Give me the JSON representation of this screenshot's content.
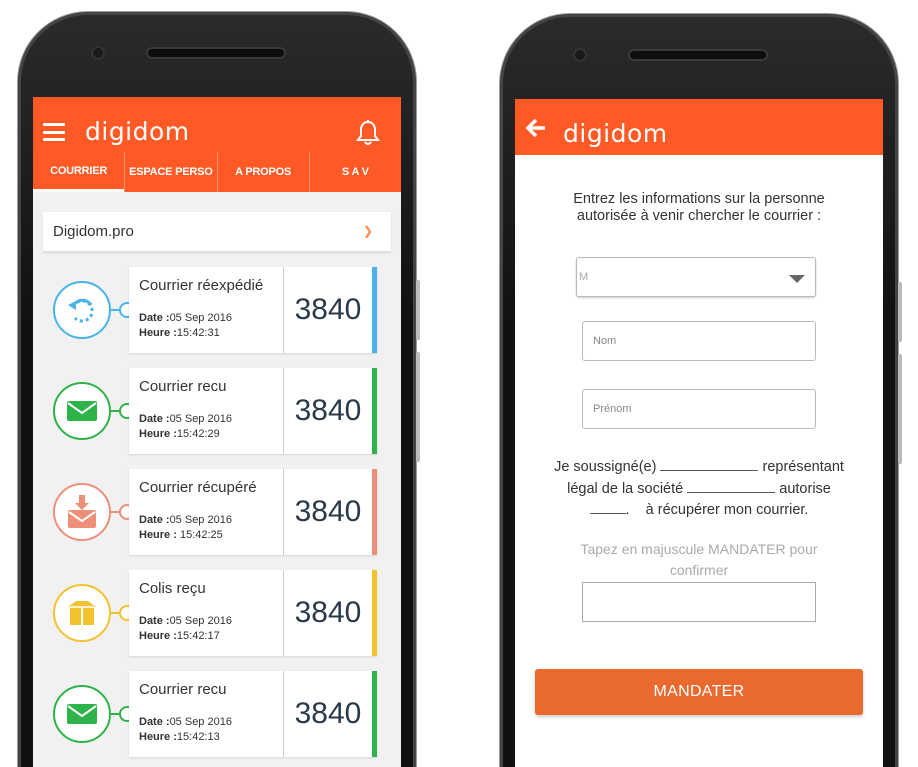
{
  "left_screen": {
    "app_name": "digidom",
    "tabs": [
      {
        "label": "COURRIER",
        "active": true
      },
      {
        "label": "ESPACE PERSO",
        "active": false
      },
      {
        "label": "A PROPOS",
        "active": false
      },
      {
        "label": "S A V",
        "active": false
      }
    ],
    "selector": {
      "value": "Digidom.pro"
    },
    "date_label": "Date :",
    "time_label": "Heure :",
    "items": [
      {
        "title": "Courrier réexpédié",
        "date": "05 Sep 2016",
        "time": "15:42:31",
        "number": "3840",
        "color": "#4ab3ea",
        "icon": "redirect-icon"
      },
      {
        "title": "Courrier recu",
        "date": "05 Sep 2016",
        "time": "15:42:29",
        "number": "3840",
        "color": "#2db34a",
        "icon": "envelope-icon"
      },
      {
        "title": "Courrier récupéré",
        "date": "05 Sep 2016",
        "time": " 15:42:25",
        "number": "3840",
        "color": "#ee8f7a",
        "icon": "pickup-icon"
      },
      {
        "title": "Colis reçu",
        "date": "05 Sep 2016",
        "time": "15:42:17",
        "number": "3840",
        "color": "#f2c230",
        "icon": "package-icon"
      },
      {
        "title": "Courrier recu",
        "date": "05 Sep 2016",
        "time": "15:42:13",
        "number": "3840",
        "color": "#2db34a",
        "icon": "envelope-icon"
      }
    ]
  },
  "right_screen": {
    "app_name": "digidom",
    "intro_line1": "Entrez les informations sur la personne",
    "intro_line2": "autorisée à venir chercher le courrier :",
    "civility_value": "M",
    "last_name_placeholder": "Nom",
    "first_name_placeholder": "Prénom",
    "decl_part1": "Je soussigné(e)",
    "decl_part2": "représentant",
    "decl_part3": "légal de la société",
    "decl_part4": "autorise",
    "decl_part5": "à récupérer mon courrier.",
    "confirm_hint_line1": "Tapez en majuscule MANDATER pour",
    "confirm_hint_line2": "confirmer",
    "submit_label": "MANDATER"
  },
  "colors": {
    "brand": "#ff5a26",
    "button": "#e9692e"
  }
}
